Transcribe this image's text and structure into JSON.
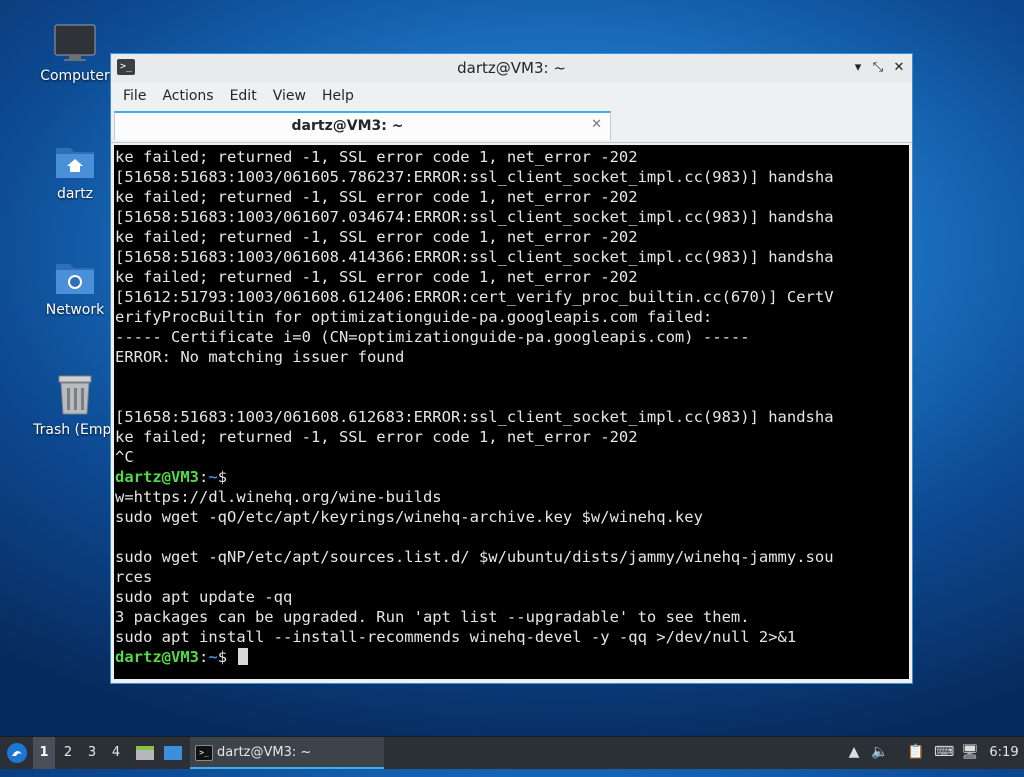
{
  "desktop": {
    "icons": [
      {
        "label": "Computer",
        "icon": "computer-icon"
      },
      {
        "label": "dartz",
        "icon": "home-folder-icon"
      },
      {
        "label": "Network",
        "icon": "network-folder-icon"
      },
      {
        "label": "Trash (Empt",
        "icon": "trash-icon"
      }
    ]
  },
  "window": {
    "title": "dartz@VM3: ~",
    "controls": {
      "minimize": "▾",
      "maximize": "⤡",
      "close": "✕"
    },
    "menu": [
      "File",
      "Actions",
      "Edit",
      "View",
      "Help"
    ],
    "tab": {
      "label": "dartz@VM3: ~",
      "close": "✕"
    }
  },
  "terminal": {
    "lines": [
      "ke failed; returned -1, SSL error code 1, net_error -202",
      "[51658:51683:1003/061605.786237:ERROR:ssl_client_socket_impl.cc(983)] handsha",
      "ke failed; returned -1, SSL error code 1, net_error -202",
      "[51658:51683:1003/061607.034674:ERROR:ssl_client_socket_impl.cc(983)] handsha",
      "ke failed; returned -1, SSL error code 1, net_error -202",
      "[51658:51683:1003/061608.414366:ERROR:ssl_client_socket_impl.cc(983)] handsha",
      "ke failed; returned -1, SSL error code 1, net_error -202",
      "[51612:51793:1003/061608.612406:ERROR:cert_verify_proc_builtin.cc(670)] CertV",
      "erifyProcBuiltin for optimizationguide-pa.googleapis.com failed:",
      "----- Certificate i=0 (CN=optimizationguide-pa.googleapis.com) -----",
      "ERROR: No matching issuer found",
      "",
      "",
      "[51658:51683:1003/061608.612683:ERROR:ssl_client_socket_impl.cc(983)] handsha",
      "ke failed; returned -1, SSL error code 1, net_error -202",
      "^C"
    ],
    "prompt": {
      "user": "dartz@VM3",
      "colon": ":",
      "path": "~",
      "sign": "$"
    },
    "lines2": [
      "w=https://dl.winehq.org/wine-builds",
      "sudo wget -qO/etc/apt/keyrings/winehq-archive.key $w/winehq.key",
      "",
      "sudo wget -qNP/etc/apt/sources.list.d/ $w/ubuntu/dists/jammy/winehq-jammy.sou",
      "rces",
      "sudo apt update -qq",
      "3 packages can be upgraded. Run 'apt list --upgradable' to see them.",
      "sudo apt install --install-recommends winehq-devel -y -qq >/dev/null 2>&1"
    ]
  },
  "taskbar": {
    "workspaces": [
      "1",
      "2",
      "3",
      "4"
    ],
    "active_workspace": "1",
    "task": {
      "label": "dartz@VM3: ~"
    },
    "clock": "6:19"
  },
  "colors": {
    "prompt_user": "#54d94a",
    "prompt_path": "#3d8fdc",
    "accent": "#3daee9",
    "terminal_bg": "#000000"
  }
}
